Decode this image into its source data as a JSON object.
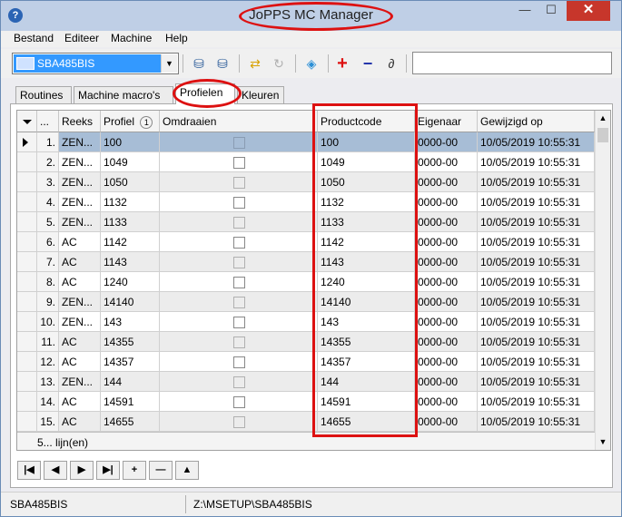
{
  "window": {
    "title": "JoPPS MC Manager",
    "close_glyph": "✕",
    "min_glyph": "—",
    "max_glyph": "☐"
  },
  "menu": [
    "Bestand",
    "Editeer",
    "Machine",
    "Help"
  ],
  "toolbar": {
    "machine_value": "SBA485BIS",
    "search_value": ""
  },
  "tabs": [
    "Routines",
    "Machine macro's",
    "Profielen",
    "Kleuren"
  ],
  "active_tab": "Profielen",
  "grid": {
    "columns": [
      "...",
      "Reeks",
      "Profiel",
      "Omdraaien",
      "Productcode",
      "Eigenaar",
      "Gewijzigd op"
    ],
    "sort_badge": "1",
    "selected_row": 1,
    "rows": [
      {
        "n": "1.",
        "reeks": "ZEN...",
        "profiel": "100",
        "productcode": "100",
        "eigenaar": "0000-00",
        "gewijzigd": "10/05/2019 10:55:31"
      },
      {
        "n": "2.",
        "reeks": "ZEN...",
        "profiel": "1049",
        "productcode": "1049",
        "eigenaar": "0000-00",
        "gewijzigd": "10/05/2019 10:55:31"
      },
      {
        "n": "3.",
        "reeks": "ZEN...",
        "profiel": "1050",
        "productcode": "1050",
        "eigenaar": "0000-00",
        "gewijzigd": "10/05/2019 10:55:31"
      },
      {
        "n": "4.",
        "reeks": "ZEN...",
        "profiel": "1132",
        "productcode": "1132",
        "eigenaar": "0000-00",
        "gewijzigd": "10/05/2019 10:55:31"
      },
      {
        "n": "5.",
        "reeks": "ZEN...",
        "profiel": "1133",
        "productcode": "1133",
        "eigenaar": "0000-00",
        "gewijzigd": "10/05/2019 10:55:31"
      },
      {
        "n": "6.",
        "reeks": "AC",
        "profiel": "1142",
        "productcode": "1142",
        "eigenaar": "0000-00",
        "gewijzigd": "10/05/2019 10:55:31"
      },
      {
        "n": "7.",
        "reeks": "AC",
        "profiel": "1143",
        "productcode": "1143",
        "eigenaar": "0000-00",
        "gewijzigd": "10/05/2019 10:55:31"
      },
      {
        "n": "8.",
        "reeks": "AC",
        "profiel": "1240",
        "productcode": "1240",
        "eigenaar": "0000-00",
        "gewijzigd": "10/05/2019 10:55:31"
      },
      {
        "n": "9.",
        "reeks": "ZEN...",
        "profiel": "14140",
        "productcode": "14140",
        "eigenaar": "0000-00",
        "gewijzigd": "10/05/2019 10:55:31"
      },
      {
        "n": "10.",
        "reeks": "ZEN...",
        "profiel": "143",
        "productcode": "143",
        "eigenaar": "0000-00",
        "gewijzigd": "10/05/2019 10:55:31"
      },
      {
        "n": "11.",
        "reeks": "AC",
        "profiel": "14355",
        "productcode": "14355",
        "eigenaar": "0000-00",
        "gewijzigd": "10/05/2019 10:55:31"
      },
      {
        "n": "12.",
        "reeks": "AC",
        "profiel": "14357",
        "productcode": "14357",
        "eigenaar": "0000-00",
        "gewijzigd": "10/05/2019 10:55:31"
      },
      {
        "n": "13.",
        "reeks": "ZEN...",
        "profiel": "144",
        "productcode": "144",
        "eigenaar": "0000-00",
        "gewijzigd": "10/05/2019 10:55:31"
      },
      {
        "n": "14.",
        "reeks": "AC",
        "profiel": "14591",
        "productcode": "14591",
        "eigenaar": "0000-00",
        "gewijzigd": "10/05/2019 10:55:31"
      },
      {
        "n": "15.",
        "reeks": "AC",
        "profiel": "14655",
        "productcode": "14655",
        "eigenaar": "0000-00",
        "gewijzigd": "10/05/2019 10:55:31"
      }
    ],
    "footer": {
      "count": "5...",
      "label": "lijn(en)"
    }
  },
  "navigator": [
    "|◀",
    "◀",
    "▶",
    "▶|",
    "+",
    "—",
    "▲"
  ],
  "status": {
    "machine": "SBA485BIS",
    "path": "Z:\\MSETUP\\SBA485BIS"
  },
  "colors": {
    "selected_row": "#a7bdd6",
    "highlight": "#dd1111",
    "title_bar": "#bfcfe6"
  }
}
